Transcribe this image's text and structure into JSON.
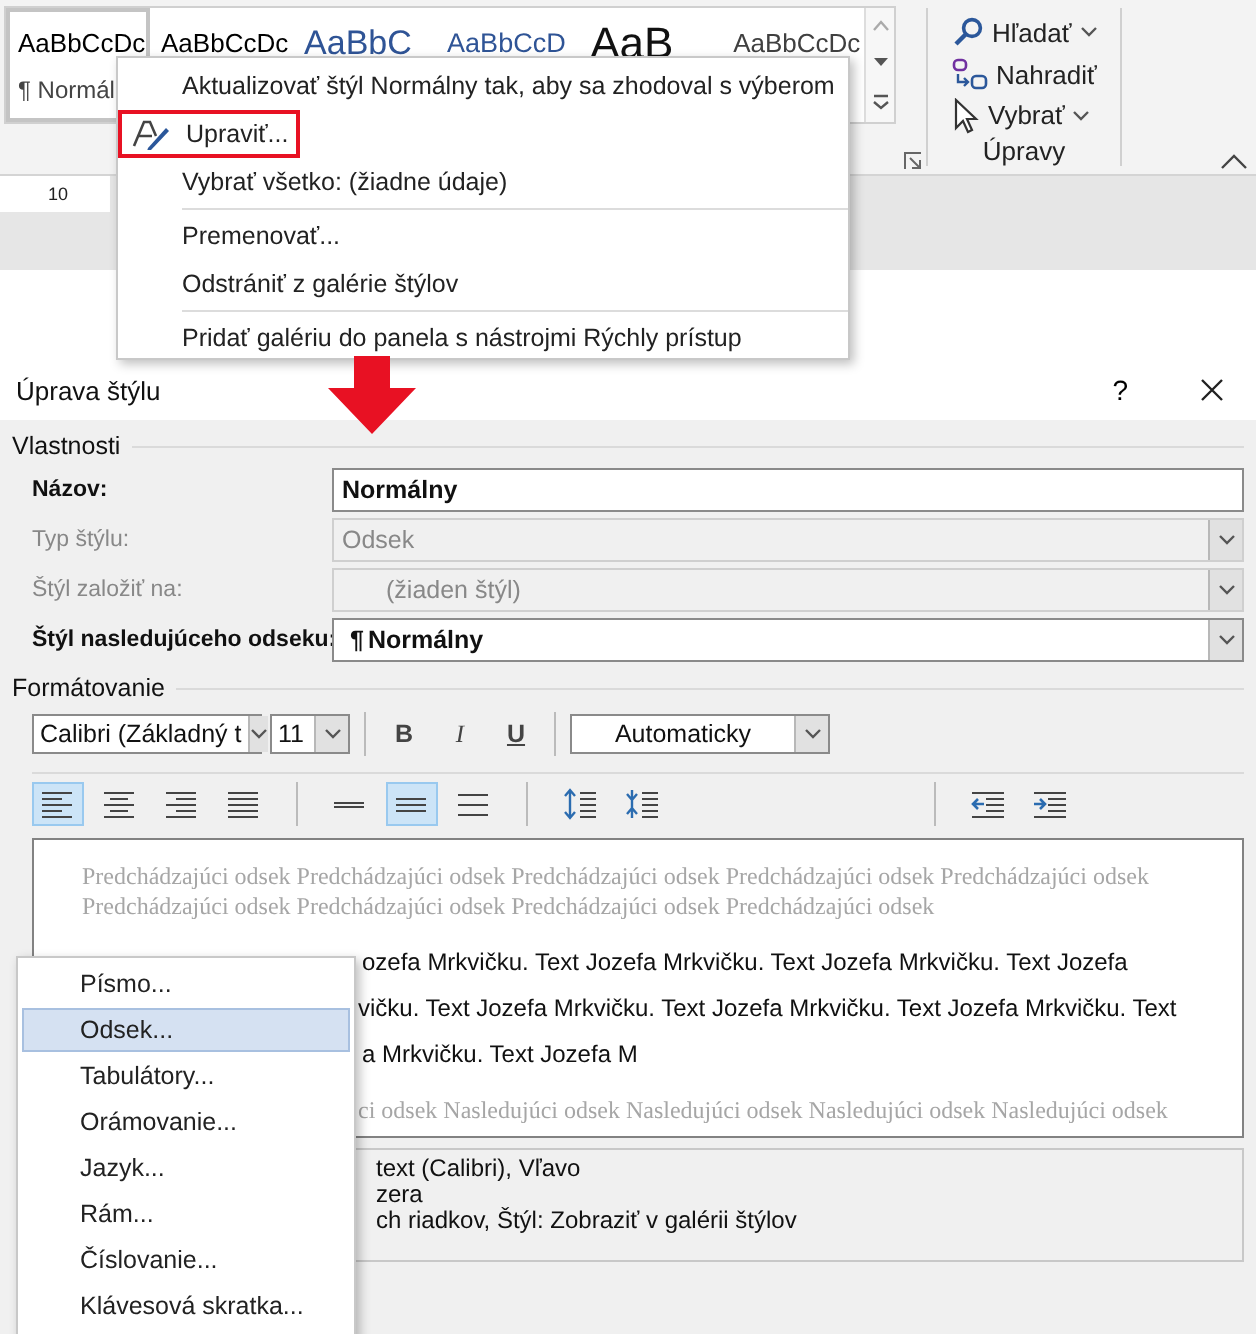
{
  "ribbon": {
    "styles": [
      {
        "preview": "AaBbCcDc",
        "label": "¶ Normál",
        "kind": "normal",
        "selected": true
      },
      {
        "preview": "AaBbCcDc",
        "kind": "normal",
        "selected": false
      },
      {
        "preview": "AaBbC",
        "kind": "heading",
        "selected": false
      },
      {
        "preview": "AaBbCcD",
        "kind": "heading2",
        "selected": false
      },
      {
        "preview": "AaB",
        "kind": "title",
        "selected": false
      },
      {
        "preview": "AaBbCcDc",
        "kind": "subtle",
        "selected": false
      }
    ],
    "editing": [
      {
        "label": "Hľadať",
        "kind": "find",
        "dropdown": true
      },
      {
        "label": "Nahradiť",
        "kind": "replace",
        "dropdown": false
      },
      {
        "label": "Vybrať",
        "kind": "select",
        "dropdown": true
      }
    ],
    "group_label": "Úpravy",
    "ruler_mark": "10"
  },
  "context_menu": {
    "items": [
      {
        "kind": "item",
        "label": "Aktualizovať štýl Normálny tak, aby sa zhodoval s výberom",
        "highlighted": false
      },
      {
        "kind": "edit",
        "label": "Upraviť...",
        "highlighted": true
      },
      {
        "kind": "item",
        "label": "Vybrať všetko: (žiadne údaje)",
        "highlighted": false
      },
      {
        "kind": "separator"
      },
      {
        "kind": "item",
        "label": "Premenovať...",
        "highlighted": false
      },
      {
        "kind": "item",
        "label": "Odstrániť z galérie štýlov",
        "highlighted": false
      },
      {
        "kind": "separator"
      },
      {
        "kind": "item",
        "label": "Pridať galériu do panela s nástrojmi Rýchly prístup",
        "highlighted": false
      }
    ]
  },
  "dialog": {
    "title": "Úprava štýlu",
    "help": "?",
    "properties": {
      "heading": "Vlastnosti",
      "rows": [
        {
          "kind": "text",
          "label": "Názov:",
          "value": "Normálny",
          "disabled": false,
          "indented": false
        },
        {
          "kind": "select",
          "label": "Typ štýlu:",
          "value": "Odsek",
          "disabled": true,
          "indented": false
        },
        {
          "kind": "select",
          "label": "Štýl založiť na:",
          "value": "(žiaden štýl)",
          "disabled": true,
          "indented": true
        },
        {
          "kind": "select",
          "label": "Štýl nasledujúceho odseku:",
          "symbol": "¶",
          "value": "Normálny",
          "disabled": false,
          "indented": false
        }
      ]
    },
    "formatting": {
      "heading": "Formátovanie",
      "font": "Calibri (Základný t",
      "size": "11",
      "text_buttons": [
        {
          "label": "B",
          "kind": "bold",
          "on": false
        },
        {
          "label": "I",
          "kind": "italic",
          "on": false
        },
        {
          "label": "U",
          "kind": "underline",
          "on": false
        }
      ],
      "color_picker": "Automaticky",
      "button_groups": [
        [
          {
            "kind": "align-left",
            "selected": true
          },
          {
            "kind": "align-center",
            "selected": false
          },
          {
            "kind": "align-right",
            "selected": false
          },
          {
            "kind": "justify",
            "selected": false
          }
        ],
        [
          {
            "kind": "single-spacing",
            "selected": false
          },
          {
            "kind": "one-half-spacing",
            "selected": true
          },
          {
            "kind": "double-spacing",
            "selected": false
          }
        ],
        [
          {
            "kind": "space-increase",
            "selected": false
          },
          {
            "kind": "space-decrease",
            "selected": false
          }
        ],
        [
          {
            "kind": "indent-decrease",
            "selected": false
          },
          {
            "kind": "indent-increase",
            "selected": false
          }
        ]
      ]
    },
    "preview": {
      "previous": [
        "Predchádzajúci odsek Predchádzajúci odsek Predchádzajúci odsek Predchádzajúci odsek Predchádzajúci odsek",
        "Predchádzajúci odsek Predchádzajúci odsek Predchádzajúci odsek Predchádzajúci odsek"
      ],
      "sample": [
        "ozefa Mrkvičku. Text Jozefa Mrkvičku. Text Jozefa Mrkvičku. Text Jozefa",
        "vičku. Text Jozefa Mrkvičku. Text Jozefa Mrkvičku. Text Jozefa Mrkvičku. Text",
        "a Mrkvičku. Text Jozefa M"
      ],
      "following": "ci odsek Nasledujúci odsek Nasledujúci odsek Nasledujúci odsek Nasledujúci odsek"
    },
    "description": [
      "text (Calibri), Vľavo",
      "zera",
      "ch riadkov, Štýl: Zobraziť v galérii štýlov"
    ]
  },
  "format_menu": {
    "items": [
      {
        "label": "Písmo...",
        "selected": false
      },
      {
        "label": "Odsek...",
        "selected": true
      },
      {
        "label": "Tabulátory...",
        "selected": false
      },
      {
        "label": "Orámovanie...",
        "selected": false
      },
      {
        "label": "Jazyk...",
        "selected": false
      },
      {
        "label": "Rám...",
        "selected": false
      },
      {
        "label": "Číslovanie...",
        "selected": false
      },
      {
        "label": "Klávesová skratka...",
        "selected": false
      }
    ]
  }
}
